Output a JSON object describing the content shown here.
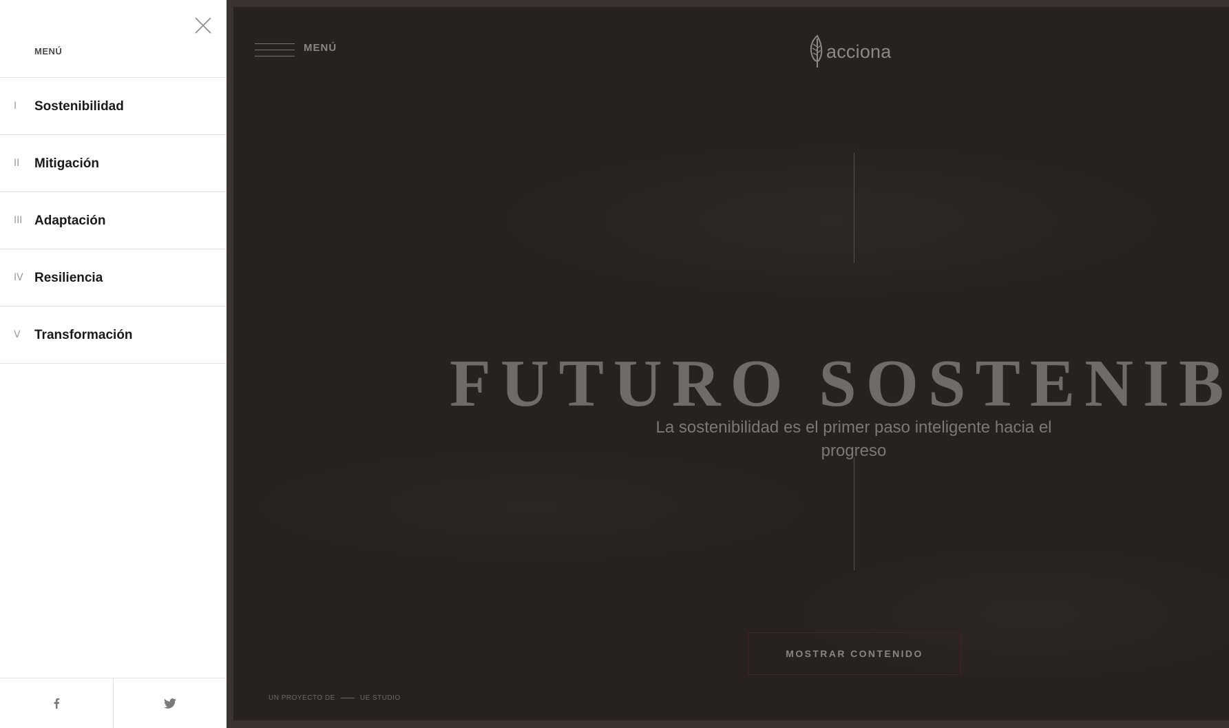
{
  "sidebar": {
    "title": "MENÚ",
    "items": [
      {
        "num": "I",
        "label": "Sostenibilidad"
      },
      {
        "num": "II",
        "label": "Mitigación"
      },
      {
        "num": "III",
        "label": "Adaptación"
      },
      {
        "num": "IV",
        "label": "Resiliencia"
      },
      {
        "num": "V",
        "label": "Transformación"
      }
    ],
    "social": [
      "facebook-icon",
      "twitter-icon"
    ]
  },
  "hero": {
    "menu_label": "MENÚ",
    "logo_text": "acciona",
    "headline": "FUTURO SOSTENIBLE",
    "subtitle": "La sostenibilidad es el primer paso inteligente hacia el progreso",
    "button_label": "MOSTRAR CONTENIDO",
    "credit_prefix": "UN PROYECTO DE",
    "credit_studio": "UE STUDIO"
  },
  "colors": {
    "sidebar_bg": "#ffffff",
    "hero_bg": "#272220",
    "frame": "#3a3330",
    "button_border": "#4a2222"
  }
}
